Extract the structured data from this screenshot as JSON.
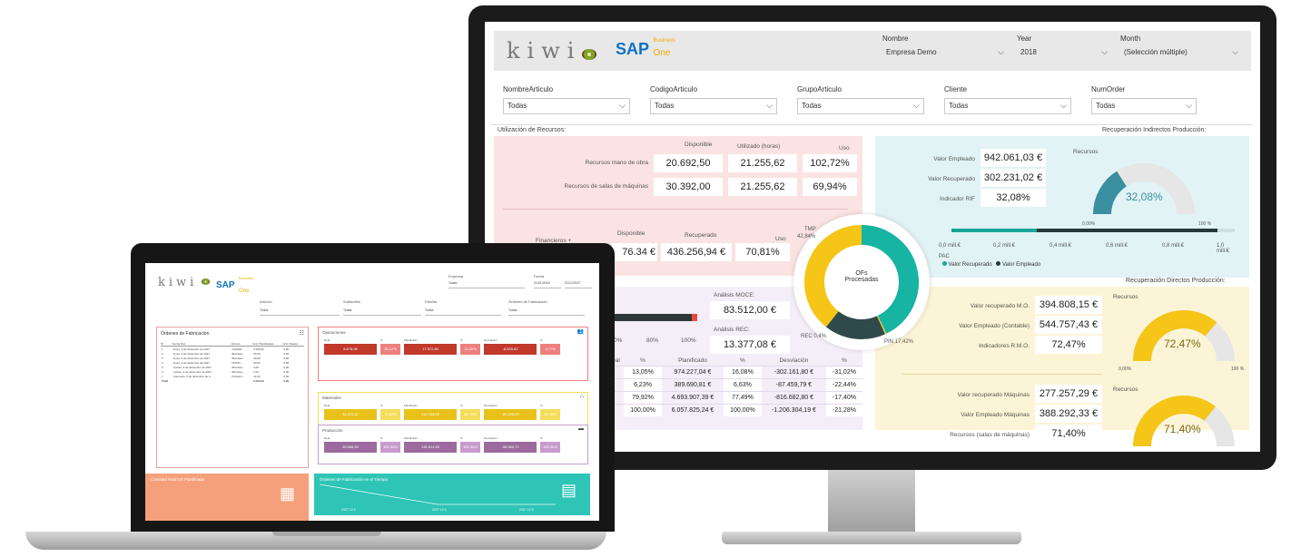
{
  "monitor": {
    "brand": {
      "kiwi": "kiwi",
      "sap": "SAP",
      "business": "Business",
      "one": "One"
    },
    "header_filters": [
      {
        "label": "Nombre",
        "value": "Empresa Demo"
      },
      {
        "label": "Year",
        "value": "2018"
      },
      {
        "label": "Month",
        "value": "(Selección múltiple)"
      }
    ],
    "filters": [
      {
        "label": "NombreArticulo",
        "value": "Todas"
      },
      {
        "label": "CodigoArticulo",
        "value": "Todas"
      },
      {
        "label": "GrupoArticulo",
        "value": "Todas"
      },
      {
        "label": "Cliente",
        "value": "Todas"
      },
      {
        "label": "NumOrder",
        "value": "Todas"
      }
    ],
    "utilizacion": {
      "title": "Utilización de Recursos:",
      "headers": [
        "Disponible",
        "Utilizado (horas)",
        "Uso"
      ],
      "rows": [
        {
          "label": "Recursos mano de obra",
          "disponible": "20.692,50",
          "utilizado": "21.255,62",
          "uso": "102,72%"
        },
        {
          "label": "Recursos de salas de máquinas",
          "disponible": "30.392,00",
          "utilizado": "21.255,62",
          "uso": "69,94%"
        }
      ],
      "fin_headers": [
        "Disponible",
        "Recuperado",
        "Uso"
      ],
      "fin_label": "Financieros +",
      "fin_row": {
        "disponible": "76.34 €",
        "recuperado": "436.256,94 €",
        "uso": "70,81%"
      }
    },
    "indirectos": {
      "title": "Recuperación Indirectos Producción:",
      "rows": [
        {
          "label": "Valor Empleado",
          "value": "942.061,03 €"
        },
        {
          "label": "Valor Recuperado",
          "value": "302.231,02 €"
        },
        {
          "label": "Indicador RIF",
          "value": "32,08%"
        }
      ],
      "gauge": {
        "title": "Recursos",
        "value": "32,08%",
        "min": "0,00%",
        "max": "100 %",
        "fraction": 0.3208
      },
      "axis": [
        "0,0 mill.€",
        "0,2 mill.€",
        "0,4 mill.€",
        "0,6 mill.€",
        "0,8 mill.€",
        "1,0 mill.€"
      ],
      "legend_prefix": "PAC",
      "legend": [
        "Valor Recuperado",
        "Valor Empleado"
      ],
      "bar_recuperado": 0.3,
      "bar_empleado": 0.94
    },
    "donut": {
      "center_line1": "OFs",
      "center_line2": "Procesadas",
      "labels": [
        "TMP",
        "42,84%",
        "REC 0,4%",
        "PIN 17,42%"
      ],
      "segments": [
        {
          "name": "TMP",
          "value": 42.84,
          "color": "#17b3a3"
        },
        {
          "name": "REC",
          "value": 0.4,
          "color": "#f5c518"
        },
        {
          "name": "PIN",
          "value": 17.42,
          "color": "#2f4a4a"
        },
        {
          "name": "Other",
          "value": 39.34,
          "color": "#f5c518"
        }
      ]
    },
    "analisis": {
      "moc_label": "Análisis MOCE:",
      "moc_value": "83.512,00 €",
      "rec_label": "Análisis REC:",
      "rec_value": "13.377,08 €",
      "pct_ticks": [
        "0%",
        "80%",
        "100%"
      ],
      "table_headers": [
        "eal",
        "%",
        "Planificado",
        "%",
        "Desviación",
        "%"
      ],
      "table_rows": [
        [
          "",
          "13,05%",
          "974.227,04 €",
          "16,08%",
          "-302.161,80 €",
          "-31,02%"
        ],
        [
          "",
          "6,23%",
          "389.690,81 €",
          "6,63%",
          "-87.459,79 €",
          "-22,44%"
        ],
        [
          "",
          "79,92%",
          "4.693.907,39 €",
          "77,49%",
          "-816.682,80 €",
          "-17,40%"
        ],
        [
          "",
          "100,00%",
          "6.057.825,24 €",
          "100,00%",
          "-1.206.304,19 €",
          "-21,28%"
        ]
      ]
    },
    "directos": {
      "title": "Recuperación Directos Producción:",
      "group1": [
        {
          "label": "Valor recuperado M.O.",
          "value": "394.808,15 €"
        },
        {
          "label": "Valor Empleado (Contable)",
          "value": "544.757,43 €"
        },
        {
          "label": "Indicadores R.M.O.",
          "value": "72,47%"
        }
      ],
      "gauge1": {
        "title": "Recursos",
        "value": "72,47%",
        "min": "0,00%",
        "max": "100 %",
        "fraction": 0.7247
      },
      "group2": [
        {
          "label": "Valor recuperado Máquinas",
          "value": "277.257,29 €"
        },
        {
          "label": "Valor Empleado Máquinas",
          "value": "388.292,33 €"
        },
        {
          "label": "Recursos (salas de máquinas)",
          "value": "71,40%"
        }
      ],
      "gauge2": {
        "title": "Recursos",
        "value": "71,40%",
        "min": "0,00%",
        "max": "100 %",
        "fraction": 0.714
      }
    }
  },
  "laptop": {
    "brand": {
      "kiwi": "kiwi",
      "sap": "SAP",
      "business": "Business",
      "one": "One"
    },
    "top_filters": [
      {
        "label": "Empresa",
        "value": "Todas"
      },
      {
        "label": "Fecha",
        "value": "01/01/2018",
        "value2": "01/12/2027"
      }
    ],
    "filters": [
      {
        "label": "Artículo",
        "value": "Todas"
      },
      {
        "label": "Subfamilia",
        "value": "Todas"
      },
      {
        "label": "Familia",
        "value": "Todas"
      },
      {
        "label": "Órdenes de Fabricación",
        "value": "Todas"
      }
    ],
    "ordenes": {
      "title": "Órdenes de Fabricación",
      "headers": [
        "Nº",
        "Fecha Doc.",
        "Artículo",
        "Und. Planificadas",
        "Und. Reales"
      ],
      "rows": [
        [
          "1",
          "lunes, 3 de diciembre de 2027",
          "AAR001 ...",
          "3.000,00",
          "0,00"
        ],
        [
          "2",
          "lunes, 3 de diciembre de 2027",
          "Bicicleta...",
          "50,00",
          "0,00"
        ],
        [
          "3",
          "lunes, 3 de diciembre de 2027",
          "Bicicleta...",
          "40,00",
          "0,00"
        ],
        [
          "4",
          "lunes, 3 de diciembre de 2027",
          "PRF01...",
          "60,00",
          "0,00"
        ],
        [
          "5",
          "martes, 4 de diciembre de 2027",
          "Bicicleta...",
          "4,00",
          "0,00"
        ],
        [
          "6",
          "martes, 4 de diciembre de 2027",
          "Bicicleta...",
          "2,00",
          "0,00"
        ],
        [
          "7",
          "miércoles, 5 de diciembre de 2...",
          "Porfesor...",
          "12,00",
          "0,00"
        ]
      ],
      "total": [
        "Total",
        "",
        "",
        "3.124,00",
        "0,00"
      ]
    },
    "cards": [
      {
        "title": "Operaciones",
        "color": "#c0392b",
        "light": "#ef7f7f",
        "heads": [
          "Real",
          "%",
          "Planificado",
          "%",
          "Desviación",
          "%"
        ],
        "values": [
          "8.878,98",
          "25,12%",
          "17.572,60",
          "13,20%",
          "-8.693,62",
          "0,77%"
        ]
      },
      {
        "title": "Materiales",
        "color": "#e8c21a",
        "light": "#f7dc5a",
        "heads": [
          "Real",
          "%",
          "Planificado",
          "%",
          "Desviación",
          "%"
        ],
        "values": [
          "34.472,61",
          "74,89%",
          "114.768,58",
          "86,76%",
          "-80.296,09",
          "91,06%"
        ]
      },
      {
        "title": "Producción",
        "color": "#9b6b9e",
        "light": "#c89bcc",
        "heads": [
          "Real",
          "%",
          "Planificado",
          "%",
          "Desviación",
          "%"
        ],
        "values": [
          "35.568,99",
          "100,00%",
          "132.514,50",
          "100,00%",
          "-96.965,71",
          "100,00%"
        ]
      }
    ],
    "bottom": [
      {
        "title": "Cantidad Real VS Planificada",
        "color": "#f5a07a"
      },
      {
        "title": "Órdenes de Fabricación en el Tiempo",
        "color": "#2ec4b6",
        "ticks": [
          "2027 12 3",
          "2027 12 4",
          "2027 12 5"
        ]
      }
    ]
  }
}
